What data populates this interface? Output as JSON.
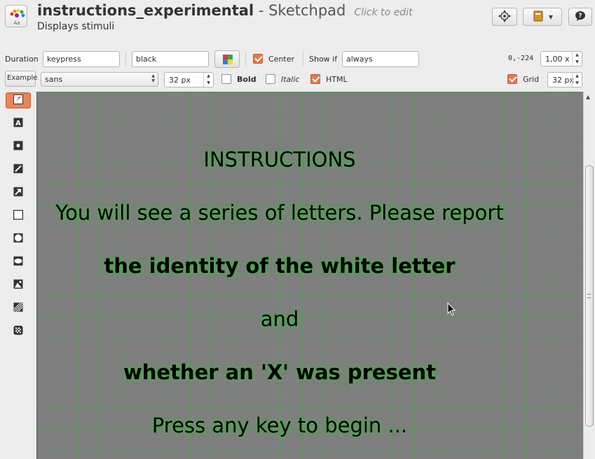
{
  "header": {
    "title": "instructions_experimental",
    "separator": " - ",
    "item_type": "Sketchpad",
    "click_to_edit": "Click to edit",
    "subtitle": "Displays stimuli"
  },
  "toolbar1": {
    "duration_label": "Duration",
    "duration_value": "keypress",
    "color_value": "black",
    "center_label": "Center",
    "center_checked": true,
    "show_if_label": "Show if",
    "show_if_value": "always",
    "coords": "0,-224",
    "zoom_value": "1,00 x"
  },
  "toolbar2": {
    "example_label": "Example",
    "font_family": "sans",
    "font_size": "32 px",
    "bold_label": "Bold",
    "bold_checked": false,
    "italic_label": "Italic",
    "italic_checked": false,
    "html_label": "HTML",
    "html_checked": true,
    "grid_label": "Grid",
    "grid_checked": true,
    "grid_size": "32 px"
  },
  "tools": [
    "pointer-tool",
    "text-tool",
    "fixdot-tool",
    "line-tool",
    "arrow-tool",
    "rect-tool",
    "circle-tool",
    "ellipse-tool",
    "image-tool",
    "gabor-tool",
    "noise-patch-tool"
  ],
  "canvas": {
    "background": "#7f7f7f",
    "grid_color": "#46a046",
    "lines": [
      {
        "text": "INSTRUCTIONS",
        "bold": false
      },
      {
        "text": "You will see a series of letters. Please report",
        "bold": false
      },
      {
        "text": "the identity of the white letter",
        "bold": true
      },
      {
        "text": "and",
        "bold": false
      },
      {
        "text": "whether an 'X' was present",
        "bold": true
      },
      {
        "text": "Press any key to begin ...",
        "bold": false
      }
    ]
  },
  "colors": {
    "accent": "#e27a4e",
    "canvas_bg": "#7f7f7f",
    "grid": "#46a046"
  }
}
